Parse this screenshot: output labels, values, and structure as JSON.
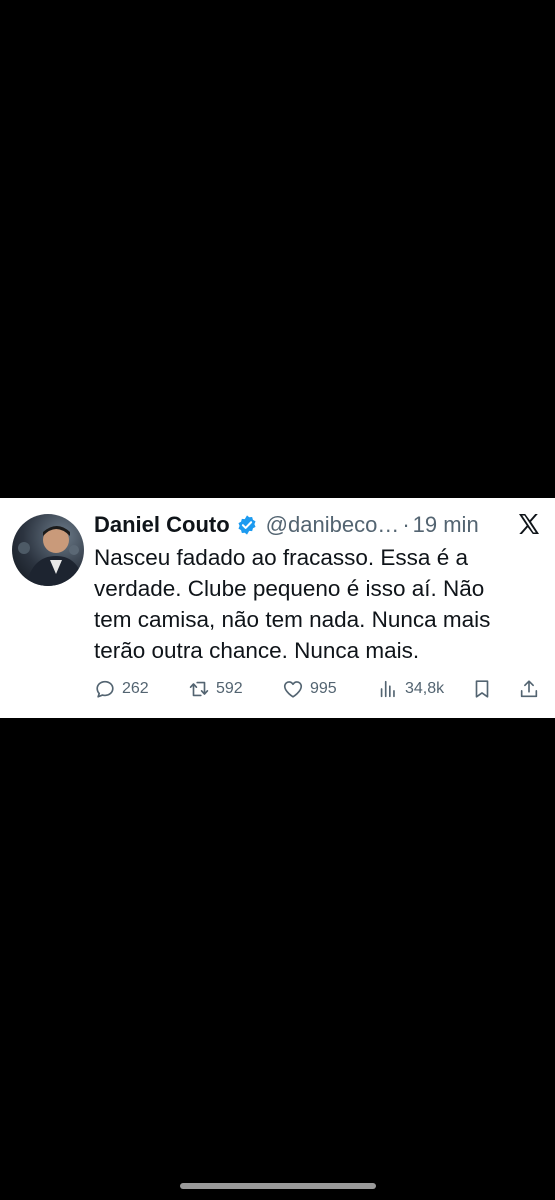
{
  "tweet": {
    "author_name": "Daniel Couto",
    "handle": "@danibeco…",
    "separator": "·",
    "time": "19 min",
    "lines": [
      "Nasceu fadado ao fracasso. Essa é a",
      "verdade. Clube pequeno é isso aí. Não",
      "tem camisa, não tem nada. Nunca mais",
      "terão outra chance. Nunca mais."
    ],
    "replies": "262",
    "retweets": "592",
    "likes": "995",
    "views": "34,8k"
  },
  "colors": {
    "text": "#0f1419",
    "secondary": "#536471",
    "verified": "#1d9bf0",
    "background": "#000000",
    "card": "#ffffff"
  },
  "icons": [
    "x-logo-icon",
    "verified-badge-icon",
    "reply-icon",
    "retweet-icon",
    "like-icon",
    "views-icon",
    "bookmark-icon",
    "share-icon"
  ]
}
